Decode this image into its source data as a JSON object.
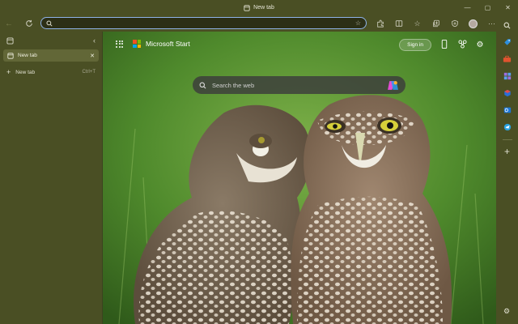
{
  "window": {
    "title": "New tab"
  },
  "toolbar": {
    "address_value": ""
  },
  "vertical_tabs": {
    "tabs": [
      {
        "label": "New tab",
        "active": true
      }
    ],
    "new_tab": {
      "label": "New tab",
      "shortcut": "Ctrl+T"
    }
  },
  "newtab_page": {
    "brand": "Microsoft Start",
    "signin_label": "Sign in",
    "search_placeholder": "Search the web"
  },
  "colors": {
    "frame": "#4a4f24",
    "active_tab": "#626737",
    "address_border": "#8fb3e8"
  },
  "icons": {
    "toolbar": [
      "back-icon",
      "refresh-icon",
      "extensions-icon",
      "split-screen-icon",
      "favorites-icon",
      "collections-icon",
      "browser-essentials-icon",
      "profile-avatar",
      "more-icon",
      "copilot-icon"
    ],
    "sidebar": [
      "search-icon",
      "shopping-tag-icon",
      "tools-icon",
      "games-icon",
      "microsoft-365-icon",
      "outlook-icon",
      "telegram-icon",
      "add-icon",
      "settings-icon"
    ]
  }
}
